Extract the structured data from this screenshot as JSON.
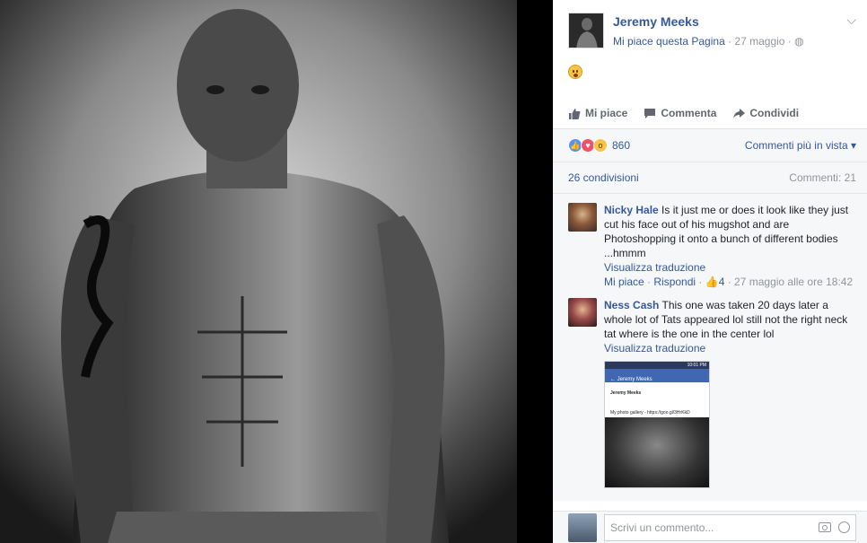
{
  "post": {
    "author": "Jeremy Meeks",
    "like_page": "Mi piace questa Pagina",
    "date": "· 27 maggio ·",
    "privacy_icon": "globe-icon",
    "menu_icon": "chevron-down-icon"
  },
  "actions": {
    "like": "Mi piace",
    "comment": "Commenta",
    "share": "Condividi"
  },
  "reactions": {
    "count": "860",
    "sort": "Commenti più in vista ▾"
  },
  "stats": {
    "shares": "26 condivisioni",
    "comments": "Commenti: 21"
  },
  "comments": [
    {
      "name": "Nicky Hale",
      "text": "Is it just me or does it look like they just cut his face out of his mugshot and are Photoshopping it onto a bunch of different bodies ...hmmm",
      "translate": "Visualizza traduzione",
      "like": "Mi piace",
      "reply": "Rispondi",
      "likes": "4",
      "time": "· 27 maggio alle ore 18:42"
    },
    {
      "name": "Ness Cash",
      "text": "This one was taken 20 days later a whole lot of Tats appeared lol still not the right neck tat where is the one in the center lol",
      "translate": "Visualizza traduzione",
      "thumb": {
        "nav": "Jeremy Meeks",
        "card_name": "Jeremy Meeks",
        "card_text": "My photo gallery - https://goo.gl/3HrKkD",
        "status_time": "10:01 PM"
      }
    }
  ],
  "composer": {
    "placeholder": "Scrivi un commento..."
  },
  "colors": {
    "link": "#365899",
    "muted": "#90949c",
    "panel": "#f6f7f9"
  }
}
